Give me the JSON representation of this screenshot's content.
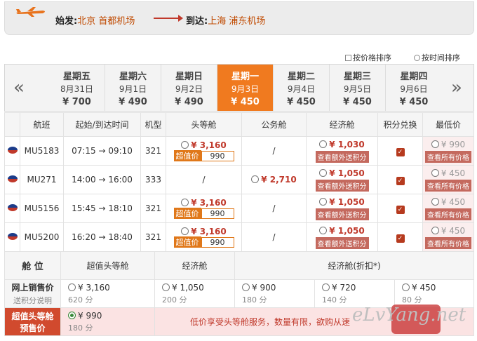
{
  "route": {
    "from_label": "始发:",
    "from_value": "北京 首都机场",
    "to_label": "到达:",
    "to_value": "上海 浦东机场"
  },
  "sort": {
    "price": "按价格排序",
    "time": "按时间排序"
  },
  "days": [
    {
      "week": "星期五",
      "date": "8月31日",
      "price": "¥ 700"
    },
    {
      "week": "星期六",
      "date": "9月1日",
      "price": "¥ 490"
    },
    {
      "week": "星期日",
      "date": "9月2日",
      "price": "¥ 490"
    },
    {
      "week": "星期一",
      "date": "9月3日",
      "price": "¥ 450"
    },
    {
      "week": "星期二",
      "date": "9月4日",
      "price": "¥ 450"
    },
    {
      "week": "星期三",
      "date": "9月5日",
      "price": "¥ 450"
    },
    {
      "week": "星期四",
      "date": "9月6日",
      "price": "¥ 450"
    }
  ],
  "table": {
    "headers": [
      "",
      "航班",
      "起始/到达时间",
      "机型",
      "头等舱",
      "公务舱",
      "经济舱",
      "积分兑换",
      "最低价"
    ],
    "promo": "超值价",
    "view_extra": "查看额外送积分",
    "view_all": "查看所有价格",
    "rows": [
      {
        "flight": "MU5183",
        "time": "07:15 → 09:10",
        "type": "321",
        "first": "¥ 3,160",
        "promo_price": "990",
        "business": "/",
        "econ": "¥ 1,030",
        "low": "¥ 990"
      },
      {
        "flight": "MU271",
        "time": "14:00 → 16:00",
        "type": "333",
        "first": "/",
        "promo_price": "",
        "business": "¥ 2,710",
        "econ": "¥ 1,050",
        "low": "¥ 450"
      },
      {
        "flight": "MU5156",
        "time": "15:45 → 18:10",
        "type": "321",
        "first": "¥ 3,160",
        "promo_price": "990",
        "business": "/",
        "econ": "¥ 1,050",
        "low": "¥ 450"
      },
      {
        "flight": "MU5200",
        "time": "16:20 → 18:40",
        "type": "321",
        "first": "¥ 3,160",
        "promo_price": "990",
        "business": "/",
        "econ": "¥ 1,050",
        "low": "¥ 450"
      }
    ]
  },
  "fare": {
    "seat_label": "舱 位",
    "col1": "超值头等舱",
    "col2": "经济舱",
    "col3": "经济舱(折扣*)",
    "online_label": "网上销售价",
    "online_sub": "送积分说明",
    "online": [
      {
        "price": "¥ 3,160",
        "pts": "620 分"
      },
      {
        "price": "¥ 1,050",
        "pts": "200 分"
      },
      {
        "price": "¥ 900",
        "pts": "180 分"
      },
      {
        "price": "¥ 720",
        "pts": "140 分"
      },
      {
        "price": "¥ 450",
        "pts": "80 分"
      }
    ],
    "pre_label1": "超值头等舱",
    "pre_label2": "预售价",
    "pre_price": "¥ 990",
    "pre_pts": "180 分",
    "pre_note": "低价享受头等舱服务，数量有限，欲购从速"
  },
  "watermark": "eLvYang.net"
}
